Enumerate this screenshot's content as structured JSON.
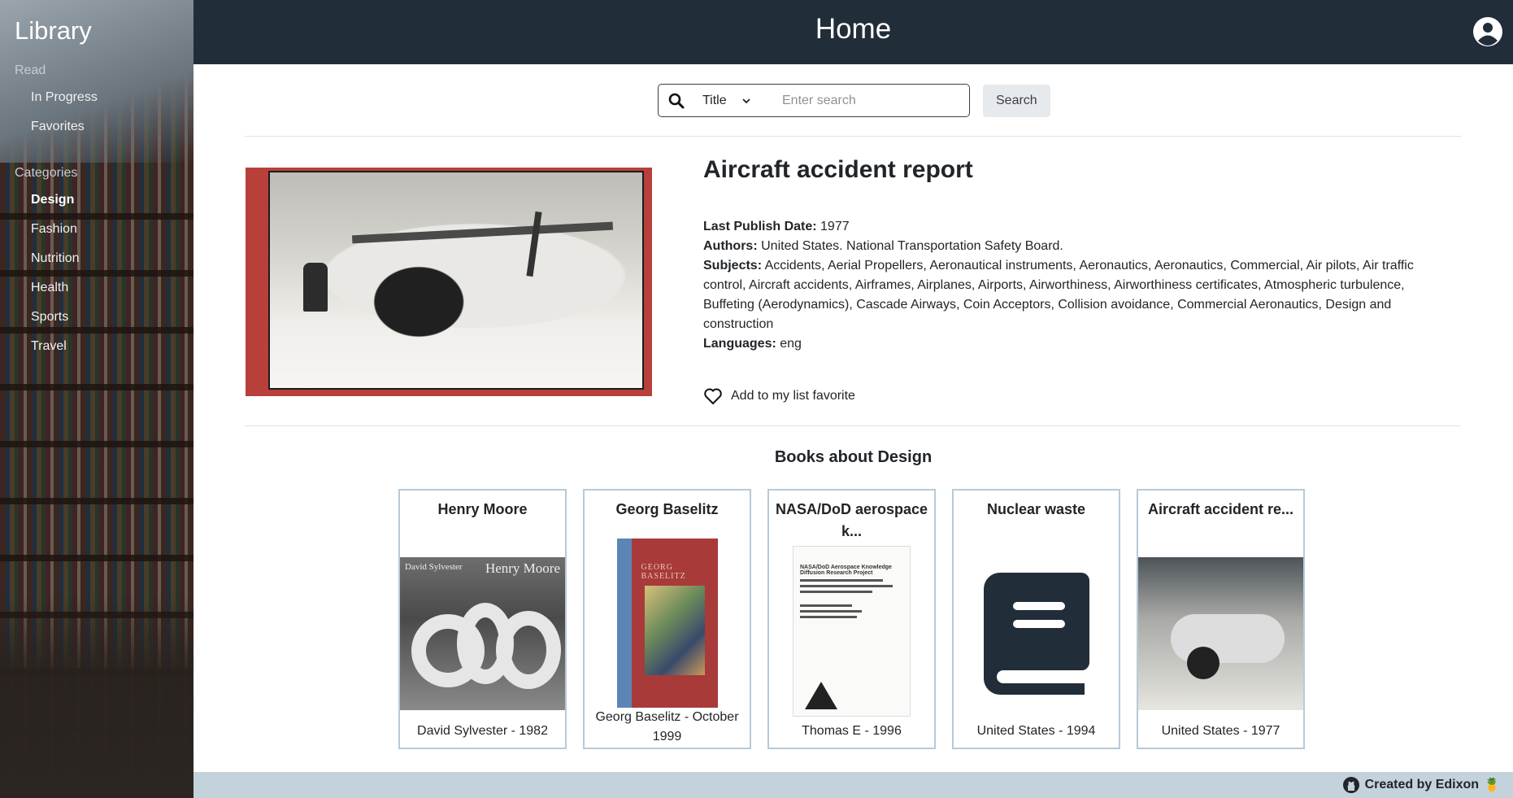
{
  "sidebar": {
    "brand": "Library",
    "sections": [
      {
        "heading": "Read",
        "items": [
          {
            "label": "In Progress"
          },
          {
            "label": "Favorites"
          }
        ]
      },
      {
        "heading": "Categories",
        "items": [
          {
            "label": "Design",
            "active": true
          },
          {
            "label": "Fashion"
          },
          {
            "label": "Nutrition"
          },
          {
            "label": "Health"
          },
          {
            "label": "Sports"
          },
          {
            "label": "Travel"
          }
        ]
      }
    ]
  },
  "topbar": {
    "title": "Home",
    "user_icon": "user-circle-icon"
  },
  "search": {
    "icon": "search-icon",
    "field_selected": "Title",
    "placeholder": "Enter search",
    "value": "",
    "button_label": "Search"
  },
  "book": {
    "title": "Aircraft accident report",
    "last_publish_label": "Last Publish Date:",
    "last_publish_value": "1977",
    "authors_label": "Authors:",
    "authors_value": "United States. National Transportation Safety Board.",
    "subjects_label": "Subjects:",
    "subjects_value": "Accidents, Aerial Propellers, Aeronautical instruments, Aeronautics, Aeronautics, Commercial, Air pilots, Air traffic control, Aircraft accidents, Airframes, Airplanes, Airports, Airworthiness, Airworthiness certificates, Atmospheric turbulence, Buffeting (Aerodynamics), Cascade Airways, Coin Acceptors, Collision avoidance, Commercial Aeronautics, Design and construction",
    "languages_label": "Languages:",
    "languages_value": "eng",
    "favorite_label": "Add to my list favorite",
    "favorite_icon": "heart-icon"
  },
  "related": {
    "heading": "Books about Design",
    "cards": [
      {
        "title": "Henry Moore",
        "subtitle": "David Sylvester - 1982",
        "cover_text_author": "David Sylvester",
        "cover_text_title": "Henry Moore"
      },
      {
        "title": "Georg Baselitz",
        "subtitle": "Georg Baselitz - October 1999",
        "cover_text": "GEORG BASELITZ"
      },
      {
        "title": "NASA/DoD aerospace k...",
        "subtitle": "Thomas E - 1996",
        "cover_text": "NASA/DoD Aerospace Knowledge Diffusion Research Project"
      },
      {
        "title": "Nuclear waste",
        "subtitle": "United States - 1994",
        "cover_icon": "book-icon"
      },
      {
        "title": "Aircraft accident re...",
        "subtitle": "United States - 1977"
      }
    ]
  },
  "footer": {
    "text": "Created by Edixon",
    "icon": "github-icon",
    "emoji": "🍍"
  }
}
